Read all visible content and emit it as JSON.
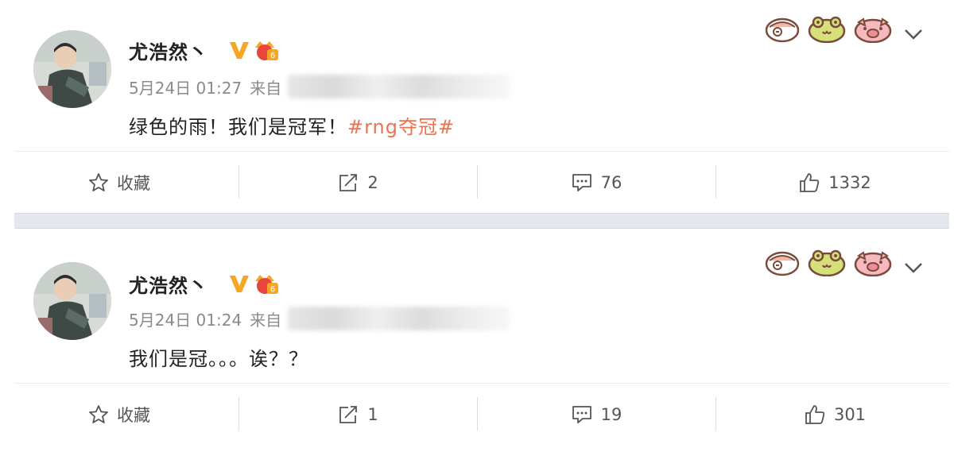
{
  "posts": [
    {
      "username": "尤浩然丶",
      "time": "5月24日 01:27",
      "source_prefix": "来自",
      "content_text": "绿色的雨！我们是冠军！",
      "hashtag": "#rng夺冠#",
      "actions": {
        "favorite_label": "收藏",
        "repost_count": "2",
        "comment_count": "76",
        "like_count": "1332"
      }
    },
    {
      "username": "尤浩然丶",
      "time": "5月24日 01:24",
      "source_prefix": "来自",
      "content_text": "我们是冠。。。诶？？",
      "hashtag": "",
      "actions": {
        "favorite_label": "收藏",
        "repost_count": "1",
        "comment_count": "19",
        "like_count": "301"
      }
    }
  ],
  "colors": {
    "hashtag": "#eb7350",
    "verified_badge": "#f5a623",
    "separator": "#e4e7ee"
  },
  "icons": {
    "verified": "verified-v-icon",
    "level": "vip-level-icon",
    "stickers": [
      "face-sticker-icon",
      "frog-sticker-icon",
      "pig-sticker-icon"
    ],
    "menu": "chevron-down-icon",
    "favorite": "star-icon",
    "repost": "repost-icon",
    "comment": "comment-icon",
    "like": "thumbs-up-icon"
  }
}
